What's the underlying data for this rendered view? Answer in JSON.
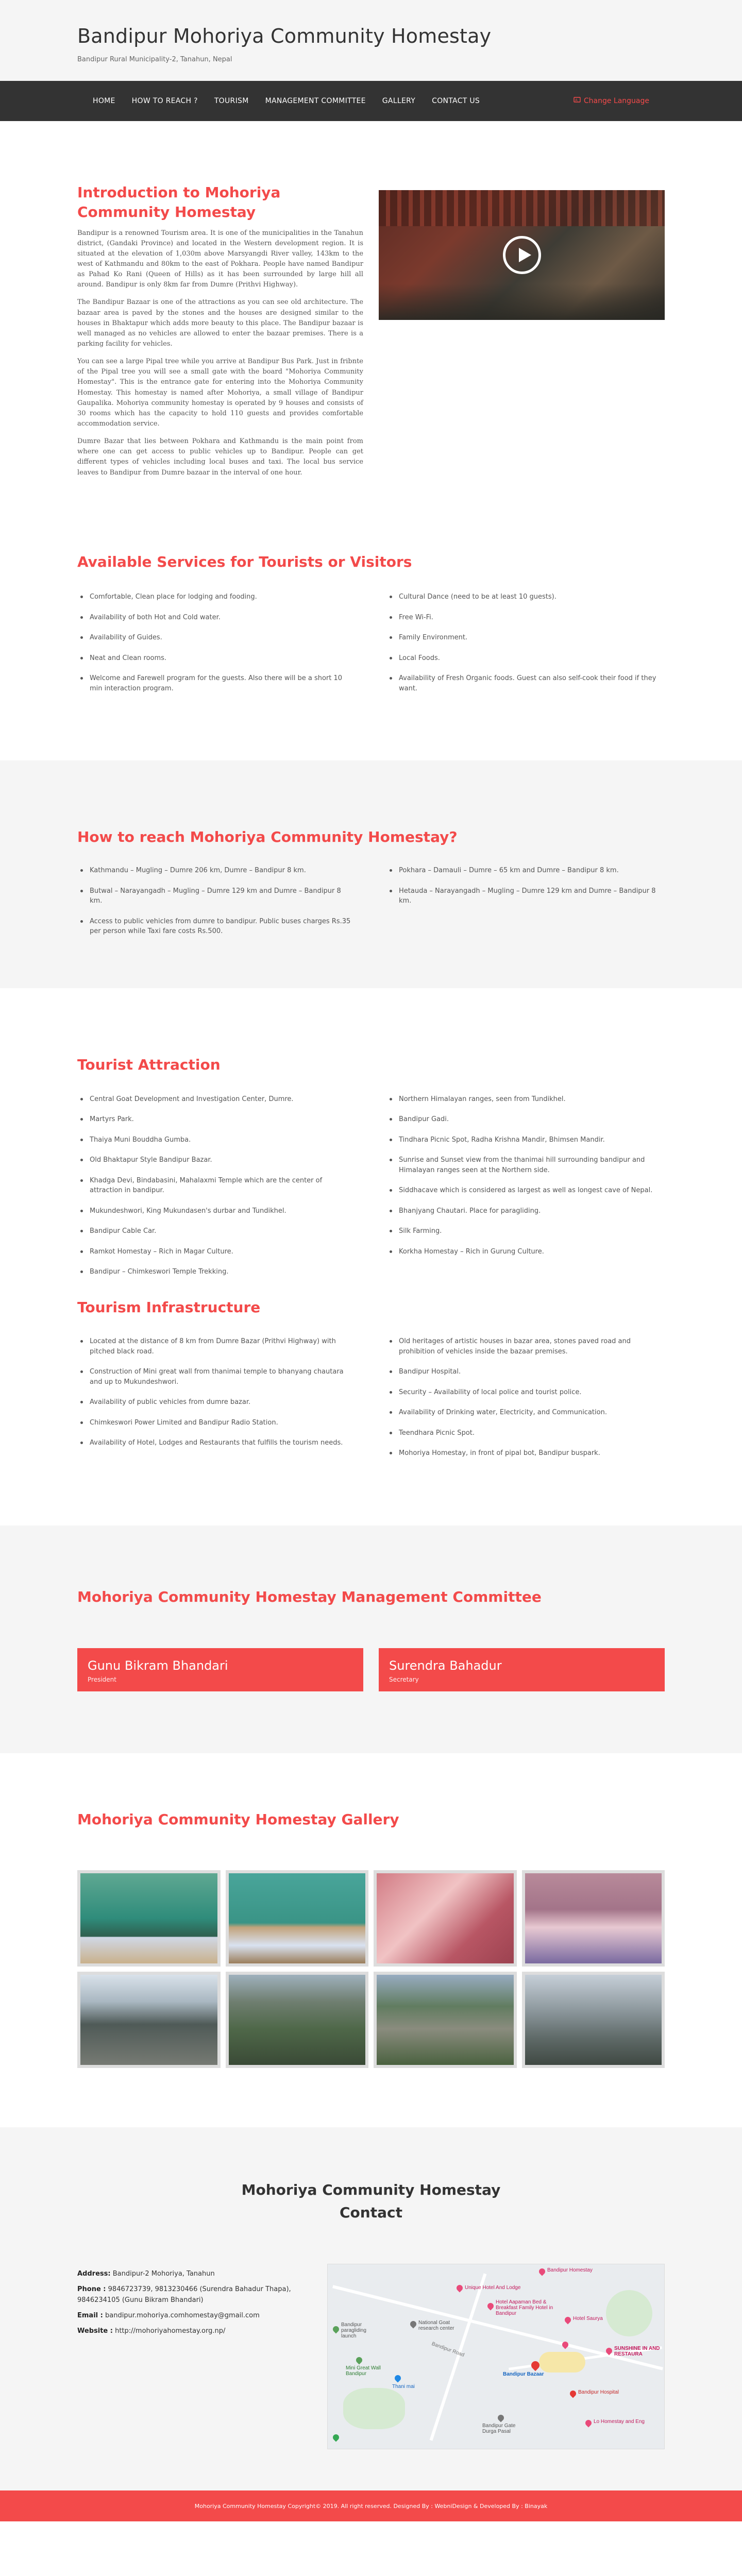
{
  "header": {
    "title": "Bandipur Mohoriya Community Homestay",
    "subtitle": "Bandipur Rural Municipality-2, Tanahun, Nepal"
  },
  "nav": {
    "items": [
      "HOME",
      "HOW TO REACH ?",
      "TOURISM",
      "MANAGEMENT COMMITTEE",
      "GALLERY",
      "CONTACT US"
    ],
    "language_label": "Change Language",
    "language_icon": "language-icon"
  },
  "intro": {
    "title": "Introduction to Mohoriya Community Homestay",
    "paragraphs": [
      "Bandipur is a renowned Tourism area. It is one of the municipalities in the Tanahun district, (Gandaki Province) and located in the Western development region. It is situated at the elevation of 1,030m above Marsyangdi River valley, 143km to the west of Kathmandu and 80km to the east of Pokhara. People have named Bandipur as Pahad Ko Rani (Queen of Hills) as it has been surrounded by large hill all around. Bandipur is only 8km far from Dumre (Prithvi Highway).",
      "The Bandipur Bazaar is one of the attractions as you can see old architecture. The bazaar area is paved by the stones and the houses are designed similar to the houses in Bhaktapur which adds more beauty to this place. The Bandipur bazaar is well managed as no vehicles are allowed to enter the bazaar premises. There is a parking facility for vehicles.",
      "You can see a large Pipal tree while you arrive at Bandipur Bus Park. Just in fribnte of the Pipal tree you will see a small gate with the board \"Mohoriya Community Homestay\". This is the entrance gate for entering into the Mohoriya Community Homestay. This homestay is named after Mohoriya, a small village of Bandipur Gaupalika. Mohoriya community homestay is operated by 9 houses and consists of 30 rooms which has the capacity to hold 110 guests and provides comfortable accommodation service.",
      "Dumre Bazar that lies between Pokhara and Kathmandu is the main point from where one can get access to public vehicles up to Bandipur. People can get different types of vehicles including local buses and taxi. The local bus service leaves to Bandipur from Dumre bazaar in the interval of one hour."
    ],
    "video_icon": "play-icon"
  },
  "services": {
    "title": "Available Services for Tourists or Visitors",
    "left": [
      "Comfortable, Clean place for lodging and fooding.",
      "Availability of both Hot and Cold water.",
      "Availability of Guides.",
      "Neat and Clean rooms.",
      "Welcome and Farewell program for the guests. Also there will be a short 10 min interaction program."
    ],
    "right": [
      "Cultural Dance (need to be at least 10 guests).",
      "Free Wi-Fi.",
      "Family Environment.",
      "Local Foods.",
      "Availability of Fresh Organic foods. Guest can also self-cook their food if they want."
    ]
  },
  "reach": {
    "title": "How to reach Mohoriya Community Homestay?",
    "left": [
      "Kathmandu – Mugling – Dumre 206 km, Dumre – Bandipur 8 km.",
      "Butwal – Narayangadh – Mugling – Dumre 129 km and Dumre – Bandipur 8 km.",
      "Access to public vehicles from dumre to bandipur. Public buses charges Rs.35 per person while Taxi fare costs Rs.500."
    ],
    "right": [
      "Pokhara – Damauli – Dumre – 65 km and Dumre – Bandipur 8 km.",
      "Hetauda – Narayangadh – Mugling – Dumre 129 km and Dumre – Bandipur 8 km."
    ]
  },
  "tourist": {
    "title": "Tourist Attraction",
    "left": [
      "Central Goat Development and Investigation Center, Dumre.",
      "Martyrs Park.",
      "Thaiya Muni Bouddha Gumba.",
      "Old Bhaktapur Style Bandipur Bazar.",
      "Khadga Devi, Bindabasini, Mahalaxmi Temple which are the center of attraction in bandipur.",
      "Mukundeshwori, King Mukundasen's durbar and Tundikhel.",
      "Bandipur Cable Car.",
      "Ramkot Homestay – Rich in Magar Culture.",
      "Bandipur – Chimkeswori Temple Trekking."
    ],
    "right": [
      "Northern Himalayan ranges, seen from Tundikhel.",
      "Bandipur Gadi.",
      "Tindhara Picnic Spot, Radha Krishna Mandir, Bhimsen Mandir.",
      "Sunrise and Sunset view from the thanimai hill surrounding bandipur and Himalayan ranges seen at the Northern side.",
      "Siddhacave which is considered as largest as well as longest cave of Nepal.",
      "Bhanjyang Chautari. Place for paragliding.",
      "Silk Farming.",
      "Korkha Homestay – Rich in Gurung Culture."
    ]
  },
  "infra": {
    "title": "Tourism Infrastructure",
    "left": [
      "Located at the distance of 8 km from Dumre Bazar (Prithvi Highway) with pitched black road.",
      "Construction of Mini great wall from thanimai temple to bhanyang chautara and up to Mukundeshwori.",
      "Availability of public vehicles from dumre bazar.",
      "Chimkeswori Power Limited and Bandipur Radio Station.",
      "Availability of Hotel, Lodges and Restaurants that fulfills the tourism needs."
    ],
    "right": [
      "Old heritages of artistic houses in bazar area, stones paved road and prohibition of vehicles inside the bazaar premises.",
      "Bandipur Hospital.",
      "Security – Availability of local police and tourist police.",
      "Availability of Drinking water, Electricity, and Communication.",
      "Teendhara Picnic Spot.",
      "Mohoriya Homestay, in front of pipal bot, Bandipur buspark."
    ]
  },
  "committee": {
    "title": "Mohoriya Community Homestay Management Committee",
    "members": [
      {
        "name": "Gunu Bikram Bhandari",
        "role": "President"
      },
      {
        "name": "Surendra Bahadur",
        "role": "Secretary"
      }
    ]
  },
  "gallery": {
    "title": "Mohoriya Community Homestay Gallery",
    "photos": 8
  },
  "contact": {
    "title_line1": "Mohoriya Community Homestay",
    "title_line2": "Contact",
    "address_label": "Address:",
    "address": "Bandipur-2 Mohoriya, Tanahun",
    "phone_label": "Phone :",
    "phone": "9846723739, 9813230466 (Surendra Bahadur Thapa), 9846234105 (Gunu Bikram Bhandari)",
    "email_label": "Email :",
    "email": "bandipur.mohoriya.comhomestay@gmail.com",
    "website_label": "Website :",
    "website": "http://mohoriyahomestay.org.np/",
    "map_labels": {
      "bandipur_homestay": "Bandipur Homestay",
      "unique_hotel": "Unique Hotel And Lodge",
      "hotel_aapaman": "Hotel Aapaman Bed & Breakfast Family Hotel in Bandipur",
      "hotel_saurya": "Hotel Saurya",
      "national_goat": "National Goat research center",
      "bandipur_paragliding": "Bandipur paragliding launch",
      "mini_great_wall": "Mini Great Wall Bandipur",
      "bandipur_bazaar": "Bandipur Bazaar",
      "thani_mai": "Thani mai",
      "bandipur_hospital": "Bandipur Hospital",
      "sunshine": "SUNSHINE IN AND RESTAURA",
      "lo_homestay": "Lo Homestay and Eng",
      "bandipur_gate": "Bandipur Gate Durga Pasal",
      "bandipur_road": "Bandipur Road"
    }
  },
  "footer": {
    "text": "Mohoriya Community Homestay Copyright© 2019. All right reserved. Designed By : WebniDesign & Developed By : Binayak"
  }
}
